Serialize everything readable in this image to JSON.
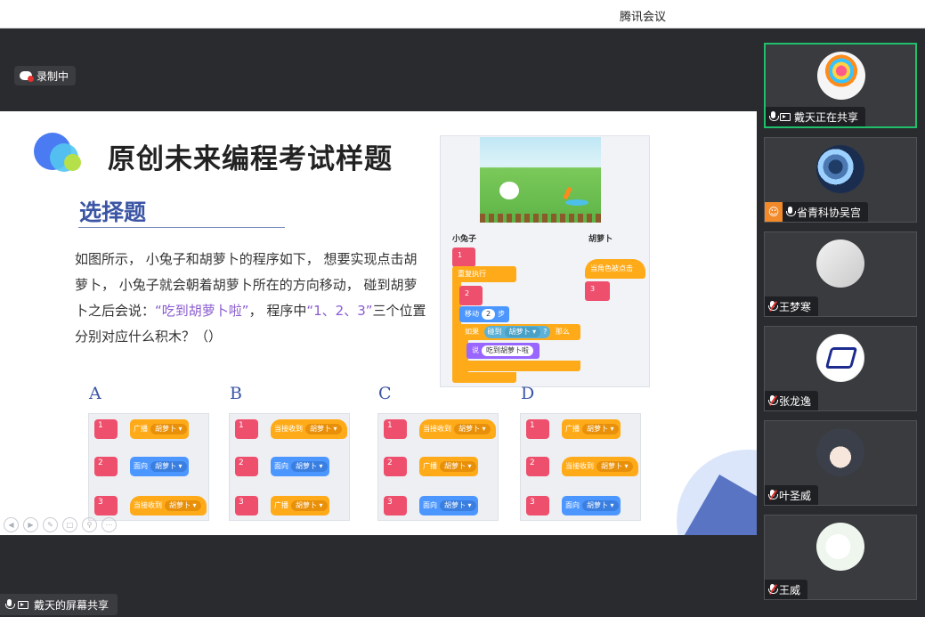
{
  "window": {
    "title": "腾讯会议"
  },
  "recording": {
    "label": "录制中"
  },
  "share_label": "戴天的屏幕共享",
  "slide": {
    "title": "原创未来编程考试样题",
    "section": "选择题",
    "question_part1": "如图所示， 小兔子和胡萝卜的程序如下， 想要实现点击胡萝卜， 小兔子就会朝着胡萝卜所在的方向移动， 碰到胡萝卜之后会说：",
    "question_quote": "“吃到胡萝卜啦”",
    "question_part2": "， 程序中",
    "question_nums": "“1、2、3”",
    "question_part3": "三个位置分别对应什么积木？（）",
    "scratch": {
      "rabbit_label": "小兔子",
      "carrot_label": "胡萝卜",
      "rabbit_blocks": {
        "slot1": "1",
        "forever": "重复执行",
        "slot2": "2",
        "move": "移动",
        "move_steps": "2",
        "move_unit": "步",
        "if": "如果",
        "touching": "碰到",
        "touching_target": "胡萝卜 ▾",
        "question": "?",
        "then": "那么",
        "say": "说",
        "say_text": "吃到胡萝卜啦"
      },
      "carrot_blocks": {
        "hat": "当角色被点击",
        "slot3": "3"
      }
    },
    "options": [
      {
        "letter": "A",
        "blocks": [
          {
            "num": "1",
            "color": "orange",
            "label": "广播",
            "pill": "胡萝卜 ▾"
          },
          {
            "num": "2",
            "color": "blue",
            "label": "面向",
            "pill": "胡萝卜 ▾"
          },
          {
            "num": "3",
            "color": "orange",
            "label": "当接收到",
            "pill": "胡萝卜 ▾"
          }
        ]
      },
      {
        "letter": "B",
        "blocks": [
          {
            "num": "1",
            "color": "orange",
            "label": "当接收到",
            "pill": "胡萝卜 ▾"
          },
          {
            "num": "2",
            "color": "blue",
            "label": "面向",
            "pill": "胡萝卜 ▾"
          },
          {
            "num": "3",
            "color": "orange",
            "label": "广播",
            "pill": "胡萝卜 ▾"
          }
        ]
      },
      {
        "letter": "C",
        "blocks": [
          {
            "num": "1",
            "color": "orange",
            "label": "当接收到",
            "pill": "胡萝卜 ▾"
          },
          {
            "num": "2",
            "color": "orange",
            "label": "广播",
            "pill": "胡萝卜 ▾"
          },
          {
            "num": "3",
            "color": "blue",
            "label": "面向",
            "pill": "胡萝卜 ▾"
          }
        ]
      },
      {
        "letter": "D",
        "blocks": [
          {
            "num": "1",
            "color": "orange",
            "label": "广播",
            "pill": "胡萝卜 ▾"
          },
          {
            "num": "2",
            "color": "orange",
            "label": "当接收到",
            "pill": "胡萝卜 ▾"
          },
          {
            "num": "3",
            "color": "blue",
            "label": "面向",
            "pill": "胡萝卜 ▾"
          }
        ]
      }
    ]
  },
  "participants": [
    {
      "name": "戴天正在共享",
      "mic": "on",
      "sharing": true,
      "active": true,
      "host": false,
      "avatar": "lollipop-avatar"
    },
    {
      "name": "省青科协吴宫",
      "mic": "on",
      "sharing": false,
      "active": false,
      "host": true,
      "avatar": "robot-avatar"
    },
    {
      "name": "王梦寒",
      "mic": "muted",
      "sharing": false,
      "active": false,
      "host": false,
      "avatar": "sketch-avatar"
    },
    {
      "name": "张龙逸",
      "mic": "muted",
      "sharing": false,
      "active": false,
      "host": false,
      "avatar": "logo-avatar"
    },
    {
      "name": "叶圣威",
      "mic": "muted",
      "sharing": false,
      "active": false,
      "host": false,
      "avatar": "anime-avatar"
    },
    {
      "name": "王威",
      "mic": "muted",
      "sharing": false,
      "active": false,
      "host": false,
      "avatar": "character-avatar"
    }
  ],
  "colors": {
    "accent_blue": "#3b55a5",
    "highlight_purple": "#8a5bd0",
    "active_border": "#1fbf6c",
    "block_orange": "#ffab19",
    "block_blue": "#4c97ff",
    "block_pink": "#ee4f6d"
  }
}
